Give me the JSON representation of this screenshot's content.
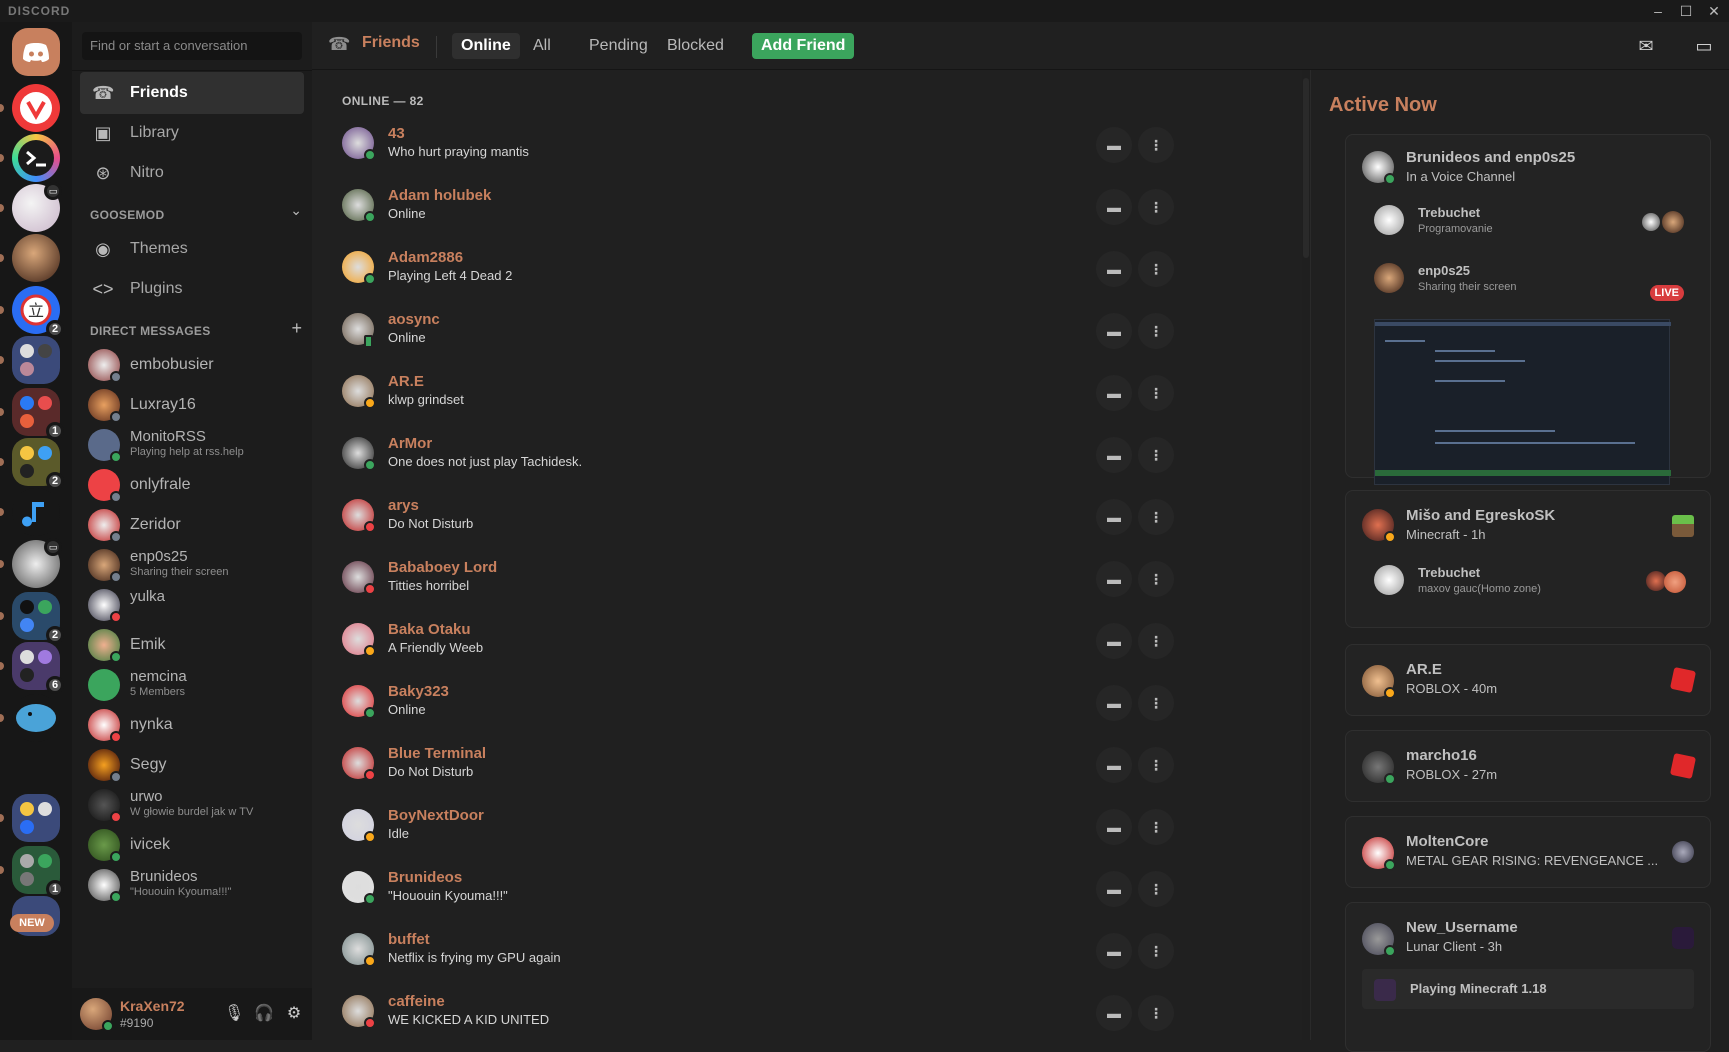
{
  "app": {
    "brand": "DISCORD"
  },
  "window": {
    "minimize": "–",
    "maximize": "☐",
    "close": "✕"
  },
  "search": {
    "placeholder": "Find or start a conversation"
  },
  "nav": {
    "friends": "Friends",
    "library": "Library",
    "nitro": "Nitro"
  },
  "goosemod": {
    "heading": "GOOSEMOD",
    "themes": "Themes",
    "plugins": "Plugins"
  },
  "dms": {
    "heading": "DIRECT MESSAGES",
    "items": [
      {
        "name": "embobusier",
        "sub": ""
      },
      {
        "name": "Luxray16",
        "sub": ""
      },
      {
        "name": "MonitoRSS",
        "sub": "Playing help at rss.help"
      },
      {
        "name": "onlyfrale",
        "sub": ""
      },
      {
        "name": "Zeridor",
        "sub": ""
      },
      {
        "name": "enp0s25",
        "sub": "Sharing their screen"
      },
      {
        "name": "yulka",
        "sub": ""
      },
      {
        "name": "Emik",
        "sub": ""
      },
      {
        "name": "nemcina",
        "sub": "5 Members"
      },
      {
        "name": "nynka",
        "sub": ""
      },
      {
        "name": "Segy",
        "sub": ""
      },
      {
        "name": "urwo",
        "sub": "W głowie burdel jak w TV"
      },
      {
        "name": "ivicek",
        "sub": ""
      },
      {
        "name": "Brunideos",
        "sub": "\"Hououin Kyouma!!!\""
      }
    ]
  },
  "user": {
    "name": "KraXen72",
    "tag": "#9190"
  },
  "guilds": {
    "badges": [
      "2",
      "1",
      "2",
      "2",
      "6",
      "1"
    ],
    "new_label": "NEW"
  },
  "topbar": {
    "title": "Friends",
    "tabs": [
      "Online",
      "All",
      "Pending",
      "Blocked"
    ],
    "add_friend": "Add Friend"
  },
  "online": {
    "heading": "ONLINE — 82",
    "friends": [
      {
        "name": "43",
        "status": "Who hurt praying mantis",
        "state": "online"
      },
      {
        "name": "Adam holubek",
        "status": "Online",
        "state": "online"
      },
      {
        "name": "Adam2886",
        "status": "Playing Left 4 Dead 2",
        "state": "online"
      },
      {
        "name": "aosync",
        "status": "Online",
        "state": "mobile"
      },
      {
        "name": "AR.E",
        "status": "klwp grindset",
        "state": "idle"
      },
      {
        "name": "ArMor",
        "status": "One does not just play Tachidesk.",
        "state": "online"
      },
      {
        "name": "arys",
        "status": "Do Not Disturb",
        "state": "dnd"
      },
      {
        "name": "Bababoey Lord",
        "status": "Titties horribel",
        "state": "dnd"
      },
      {
        "name": "Baka Otaku",
        "status": "A Friendly Weeb",
        "state": "idle"
      },
      {
        "name": "Baky323",
        "status": "Online",
        "state": "online"
      },
      {
        "name": "Blue Terminal",
        "status": "Do Not Disturb",
        "state": "dnd"
      },
      {
        "name": "BoyNextDoor",
        "status": "Idle",
        "state": "idle"
      },
      {
        "name": "Brunideos",
        "status": "\"Hououin Kyouma!!!\"",
        "state": "online"
      },
      {
        "name": "buffet",
        "status": "Netflix is frying my GPU again",
        "state": "idle"
      },
      {
        "name": "caffeine",
        "status": "WE KICKED A KID UNITED",
        "state": "dnd"
      }
    ]
  },
  "active_now": {
    "title": "Active Now",
    "voice1": {
      "title": "Brunideos and enp0s25",
      "subtitle": "In a Voice Channel",
      "m1_name": "Trebuchet",
      "m1_sub": "Programovanie",
      "m2_name": "enp0s25",
      "m2_sub": "Sharing their screen",
      "live": "LIVE"
    },
    "voice2": {
      "title": "Mišo and EgreskoSK",
      "subtitle": "Minecraft - 1h",
      "m1_name": "Trebuchet",
      "m1_sub": "maxov gauc(Homo zone)"
    },
    "are": {
      "name": "AR.E",
      "activity": "ROBLOX - 40m"
    },
    "marcho": {
      "name": "marcho16",
      "activity": "ROBLOX - 27m"
    },
    "molten": {
      "name": "MoltenCore",
      "activity": "METAL GEAR RISING: REVENGEANCE ..."
    },
    "newuser": {
      "name": "New_Username",
      "activity": "Lunar Client - 3h",
      "extra": "Playing Minecraft 1.18"
    }
  },
  "colors": {
    "accent": "#c8805e",
    "add_friend": "#3ba55d",
    "online": "#3ba55d",
    "idle": "#faa81a",
    "dnd": "#ed4245"
  }
}
